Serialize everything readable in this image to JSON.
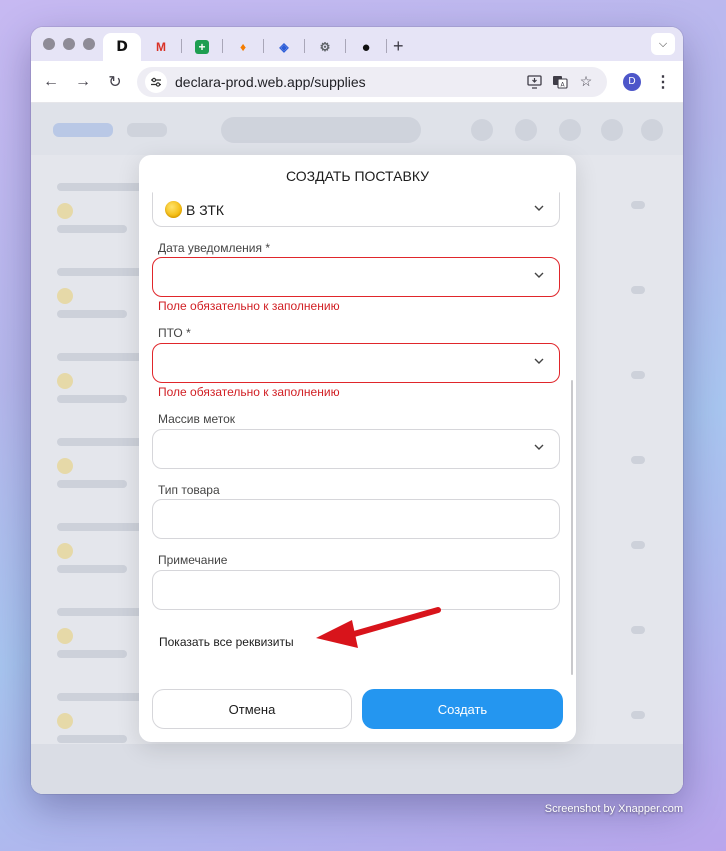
{
  "browser": {
    "tabs": [
      {
        "icon": "declara-logo-icon",
        "label": "D"
      },
      {
        "icon": "gmail-icon",
        "label": "M"
      },
      {
        "icon": "google-sheets-icon",
        "label": "+"
      },
      {
        "icon": "firebase-icon",
        "label": "♦"
      },
      {
        "icon": "bitwarden-icon",
        "label": "◈"
      },
      {
        "icon": "chrome-settings-icon",
        "label": "⚙"
      },
      {
        "icon": "github-icon",
        "label": "●"
      }
    ],
    "new_tab_label": "+",
    "url": "declara-prod.web.app/supplies",
    "profile_initial": "D"
  },
  "modal": {
    "title": "СОЗДАТЬ ПОСТАВКУ",
    "status_value": "В ЗТК",
    "fields": [
      {
        "label": "Дата уведомления *",
        "value": "",
        "error": "Поле обязательно к заполнению"
      },
      {
        "label": "ПТО *",
        "value": "",
        "error": "Поле обязательно к заполнению"
      },
      {
        "label": "Массив меток",
        "value": ""
      },
      {
        "label": "Тип товара",
        "value": ""
      },
      {
        "label": "Примечание",
        "value": ""
      }
    ],
    "show_all_link": "Показать все реквизиты",
    "cancel_label": "Отмена",
    "create_label": "Создать"
  },
  "colors": {
    "accent": "#2496f0",
    "error": "#d11f24",
    "status_dot": "#f2b705"
  },
  "watermark": "Screenshot by Xnapper.com"
}
